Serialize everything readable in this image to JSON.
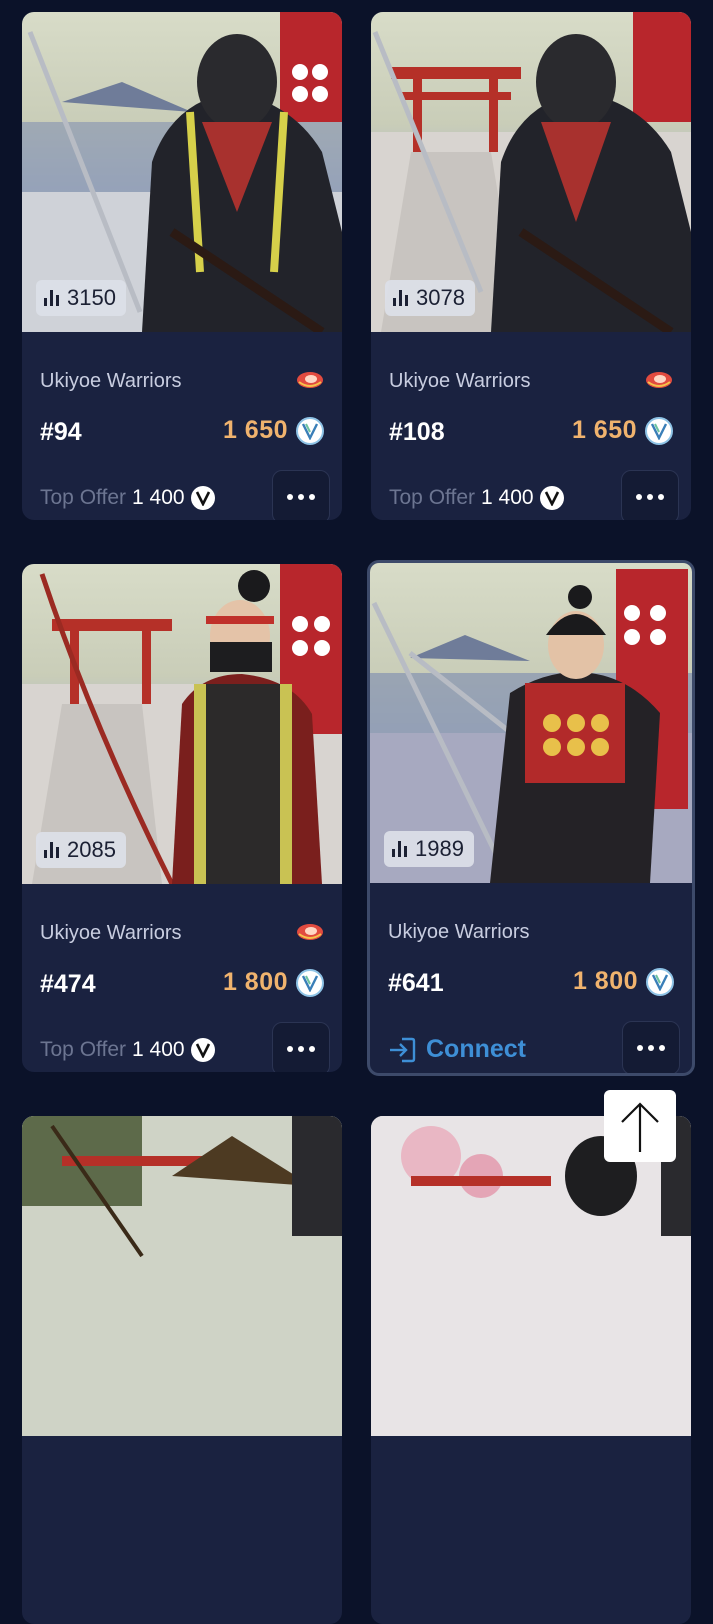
{
  "cards": [
    {
      "collection": "Ukiyoe Warriors",
      "token": "#94",
      "rank": "3150",
      "price": "1 650",
      "top_offer_label": "Top Offer",
      "top_offer_value": "1 400",
      "more_label": "More options"
    },
    {
      "collection": "Ukiyoe Warriors",
      "token": "#108",
      "rank": "3078",
      "price": "1 650",
      "top_offer_label": "Top Offer",
      "top_offer_value": "1 400",
      "more_label": "More options"
    },
    {
      "collection": "Ukiyoe Warriors",
      "token": "#474",
      "rank": "2085",
      "price": "1 800",
      "top_offer_label": "Top Offer",
      "top_offer_value": "1 400",
      "more_label": "More options"
    },
    {
      "collection": "Ukiyoe Warriors",
      "token": "#641",
      "rank": "1989",
      "price": "1 800",
      "connect_label": "Connect",
      "more_label": "More options"
    }
  ],
  "icons": {
    "rank": "bar-chart-icon",
    "currency": "vet-token-icon",
    "badge": "steak-badge-icon",
    "connect": "login-icon",
    "scroll_top": "arrow-up-icon"
  },
  "colors": {
    "background": "#0b1229",
    "card": "#1a2240",
    "price": "#f0b36e",
    "connect": "#3e8fd6",
    "offer_label": "#6c7591"
  }
}
